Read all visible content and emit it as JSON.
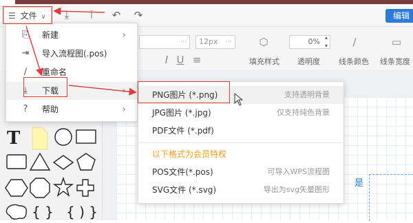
{
  "toolbar": {
    "file_menu_label": "文件",
    "edit_button_label": "编辑",
    "icons": [
      "menu-lines-icon",
      "download-icon",
      "format-paint-icon",
      "undo-icon",
      "redo-icon"
    ]
  },
  "format_bar": {
    "font_size_value": "12px",
    "opacity_value": "0%",
    "labels": [
      "填充样式",
      "透明度",
      "线条颜色",
      "线条宽度"
    ]
  },
  "file_menu": {
    "items": [
      {
        "icon": "new-file-icon",
        "label": "新建",
        "has_submenu": true
      },
      {
        "icon": "import-icon",
        "label": "导入流程图(.pos)",
        "has_submenu": false
      },
      {
        "icon": "rename-icon",
        "label": "重命名",
        "has_submenu": false
      },
      {
        "icon": "download-icon",
        "label": "下载",
        "has_submenu": true
      },
      {
        "icon": "help-icon",
        "label": "帮助",
        "has_submenu": true
      }
    ]
  },
  "download_submenu": {
    "items": [
      {
        "label": "PNG图片 (*.png)",
        "hint": "支持透明背景"
      },
      {
        "label": "JPG图片 (*.jpg)",
        "hint": "仅支持纯色背景"
      },
      {
        "label": "PDF文件 (*.pdf)",
        "hint": ""
      }
    ],
    "member_header": "以下格式为会员特权",
    "member_items": [
      {
        "label": "POS文件(*.pos)",
        "hint": "可导入WPS流程图"
      },
      {
        "label": "SVG文件 (*.svg)",
        "hint": "导出为svg矢量图形"
      }
    ]
  },
  "canvas": {
    "text_label": "是"
  },
  "colors": {
    "accent": "#2d7cdb",
    "annotation_red": "#e23b3b",
    "member_gold": "#f0a020"
  }
}
